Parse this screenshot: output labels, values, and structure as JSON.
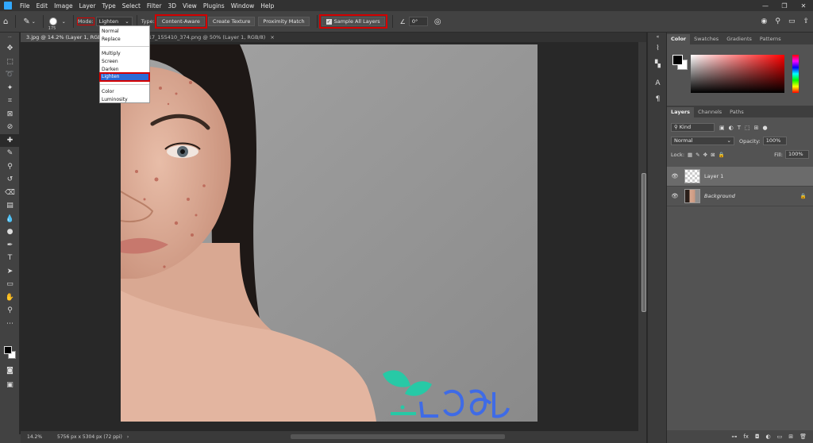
{
  "menubar": {
    "items": [
      "File",
      "Edit",
      "Image",
      "Layer",
      "Type",
      "Select",
      "Filter",
      "3D",
      "View",
      "Plugins",
      "Window",
      "Help"
    ],
    "window_controls": [
      "—",
      "❐",
      "✕"
    ]
  },
  "options": {
    "brush_size": "175",
    "mode_label": "Mode:",
    "mode_value": "Lighten",
    "type_label": "Type:",
    "content_aware": "Content-Aware",
    "create_texture": "Create Texture",
    "proximity_match": "Proximity Match",
    "sample_all_layers": "Sample All Layers",
    "angle_value": "0°"
  },
  "mode_dropdown": {
    "groups": [
      [
        "Normal",
        "Replace"
      ],
      [
        "Multiply",
        "Screen",
        "Darken",
        "Lighten"
      ],
      [
        "Color",
        "Luminosity"
      ]
    ],
    "selected": "Lighten"
  },
  "tabs": [
    {
      "label": "3.jpg @ 14.2% (Layer 1, RGB/8)",
      "active": true
    },
    {
      "label": "20230517_155410_374.png @ 50% (Layer 1, RGB/8)",
      "active": false
    }
  ],
  "status": {
    "zoom": "14.2%",
    "doc_info": "5756 px x 5304 px (72 ppi)"
  },
  "color_panel": {
    "tabs": [
      "Color",
      "Swatches",
      "Gradients",
      "Patterns"
    ]
  },
  "layers_panel": {
    "tabs": [
      "Layers",
      "Channels",
      "Paths"
    ],
    "filter_kind": "Kind",
    "blend_mode": "Normal",
    "opacity_label": "Opacity:",
    "opacity_value": "100%",
    "lock_label": "Lock:",
    "fill_label": "Fill:",
    "fill_value": "100%",
    "layers": [
      {
        "name": "Layer 1",
        "selected": true
      },
      {
        "name": "Background",
        "selected": false
      }
    ]
  },
  "colors": {
    "accent_red_outline": "#d40000",
    "selection_blue": "#2a6ad6",
    "logo_green": "#27c9a6",
    "logo_blue": "#3f6be6"
  }
}
